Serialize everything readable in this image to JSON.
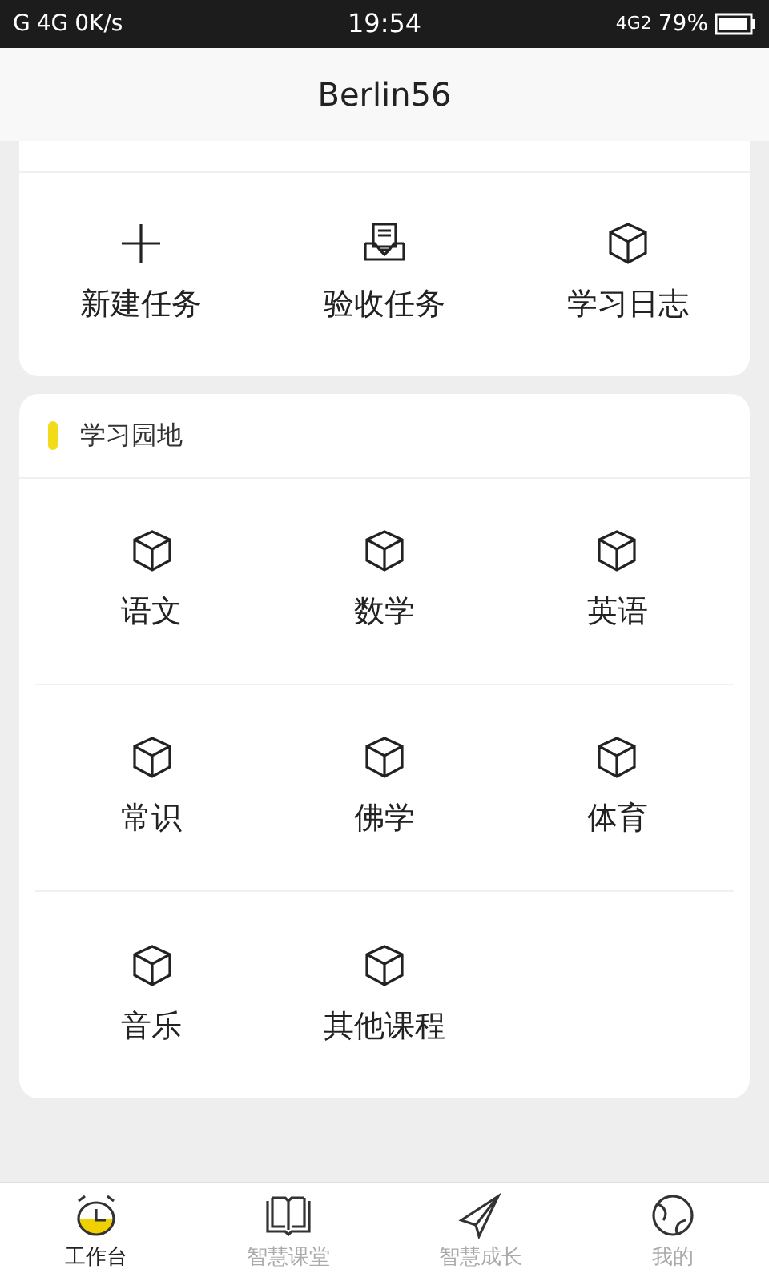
{
  "status_bar": {
    "left": [
      "G",
      "4G",
      "0K/s"
    ],
    "time": "19:54",
    "network": "4G2",
    "battery": "79%"
  },
  "header": {
    "title": "Berlin56"
  },
  "tasks": {
    "items": [
      {
        "label": "新建任务",
        "kind": "plus"
      },
      {
        "label": "验收任务",
        "kind": "inbox"
      },
      {
        "label": "学习日志",
        "kind": "cube"
      }
    ]
  },
  "study": {
    "title": "学习园地",
    "items": [
      {
        "label": "语文",
        "kind": "cube"
      },
      {
        "label": "数学",
        "kind": "cube"
      },
      {
        "label": "英语",
        "kind": "cube"
      },
      {
        "label": "常识",
        "kind": "cube"
      },
      {
        "label": "佛学",
        "kind": "cube"
      },
      {
        "label": "体育",
        "kind": "cube"
      },
      {
        "label": "音乐",
        "kind": "cube"
      },
      {
        "label": "其他课程",
        "kind": "cube"
      }
    ]
  },
  "tab_bar": [
    {
      "label": "工作台",
      "kind": "clock",
      "selected": true
    },
    {
      "label": "智慧课堂",
      "kind": "book",
      "selected": false
    },
    {
      "label": "智慧成长",
      "kind": "plane",
      "selected": false
    },
    {
      "label": "我的",
      "kind": "globe",
      "selected": false
    }
  ]
}
